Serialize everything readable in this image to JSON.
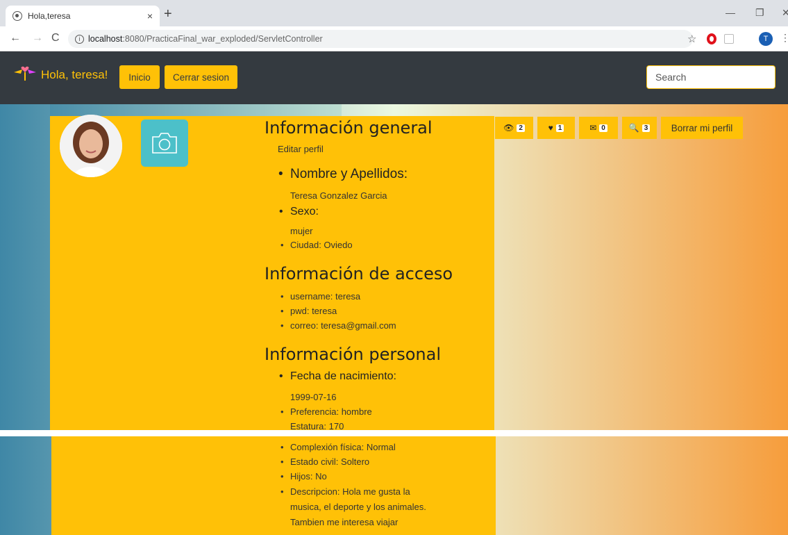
{
  "browser": {
    "tab_title": "Hola,teresa",
    "tab_close": "×",
    "new_tab": "+",
    "url_host": "localhost",
    "url_rest": ":8080/PracticaFinal_war_exploded/ServletController",
    "profile_initial": "T"
  },
  "navbar": {
    "brand": "Hola, teresa!",
    "inicio_label": "Inicio",
    "cerrar_label": "Cerrar sesion",
    "search_placeholder": "Search"
  },
  "stats": {
    "views": "2",
    "likes": "1",
    "messages": "0",
    "searches": "3",
    "delete_label": "Borrar mi perfil"
  },
  "profile": {
    "general_title": "Información general",
    "edit_label": "Editar perfil",
    "name_heading": "Nombre y Apellidos:",
    "name_value": "Teresa Gonzalez Garcia",
    "sex_heading": "Sexo:",
    "sex_value": "mujer",
    "city": "Ciudad: Oviedo",
    "access_title": "Información de acceso",
    "username": "username: teresa",
    "pwd": "pwd: teresa",
    "email": "correo: teresa@gmail.com",
    "personal_title": "Información personal",
    "birth_heading": "Fecha de nacimiento:",
    "birth_value": "1999-07-16",
    "preference": "Preferencia: hombre",
    "height": "Estatura: 170",
    "build": "Complexión física: Normal",
    "marital": "Estado civil: Soltero",
    "children": "Hijos: No",
    "description_1": "Descripcion: Hola me gusta la",
    "description_2": "musica, el deporte y los animales.",
    "description_3": "Tambien me interesa viajar"
  }
}
